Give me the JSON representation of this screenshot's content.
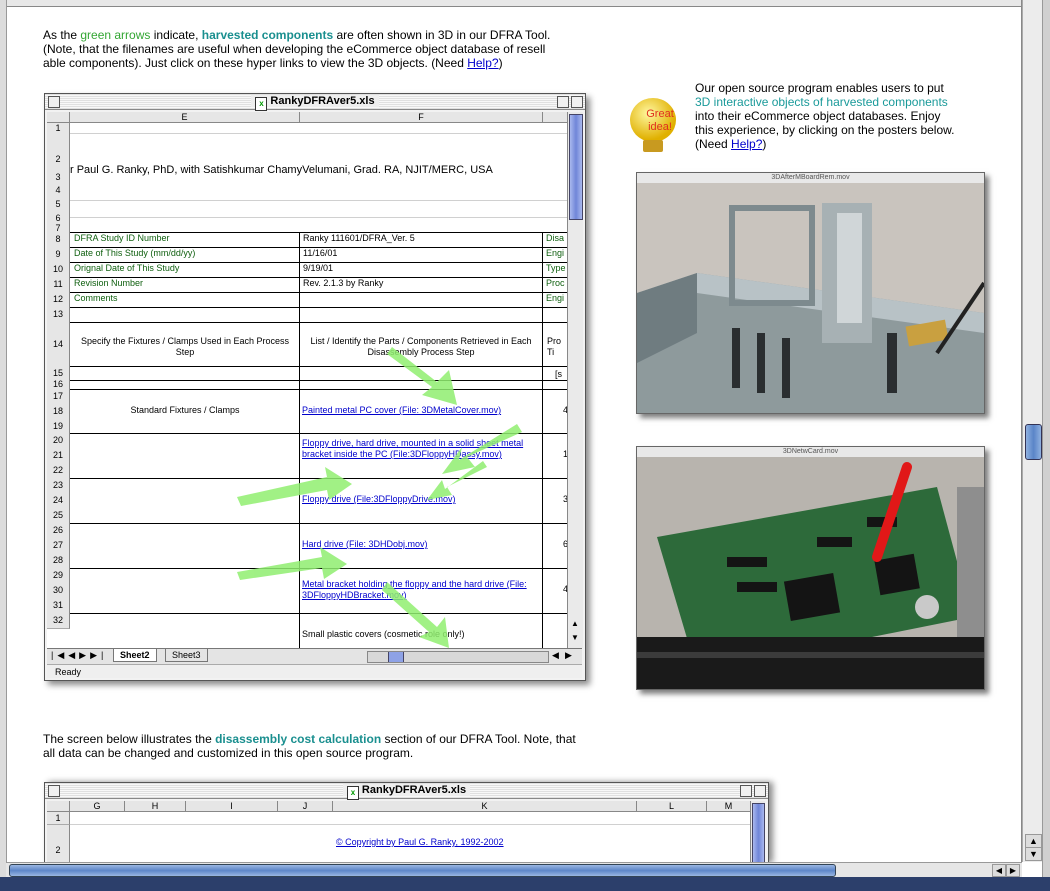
{
  "intro": {
    "t1": "As the ",
    "green": "green arrows",
    "t2": " indicate, ",
    "teal": "harvested components",
    "t3": " are often shown in 3D in our DFRA Tool.",
    "line2": "(Note, that the filenames are useful when developing the eCommerce object database of resell",
    "line3a": "able components). Just click on these hyper links to view the 3D objects. (Need ",
    "help": "Help?",
    "line3b": ")"
  },
  "side_text": {
    "line1": "Our open source program enables users to put",
    "teal": "3D interactive objects of harvested components",
    "line3": "into their eCommerce object databases. Enjoy",
    "line4": "this experience, by clicking on the posters below.",
    "line5a": "(Need ",
    "help": "Help?",
    "line5b": ")"
  },
  "great_idea": {
    "line1": "Great",
    "line2": "idea!"
  },
  "posters": [
    {
      "title": "3DAfterMBoardRem.mov"
    },
    {
      "title": "3DNetwCard.mov"
    }
  ],
  "sheet1": {
    "title": "RankyDFRAver5.xls",
    "col_e": "E",
    "col_f": "F",
    "rows": [
      "1",
      "2",
      "3",
      "4",
      "5",
      "6",
      "7",
      "8",
      "9",
      "10",
      "11",
      "12",
      "13",
      "14",
      "15",
      "16",
      "17",
      "18",
      "19",
      "20",
      "21",
      "22",
      "23",
      "24",
      "25",
      "26",
      "27",
      "28",
      "29",
      "30",
      "31",
      "32"
    ],
    "author": "r Paul G. Ranky, PhD, with Satishkumar ChamyVelumani, Grad. RA, NJIT/MERC, USA",
    "fields": [
      {
        "label": "DFRA Study ID Number",
        "value": "Ranky 111601/DFRA_Ver. 5",
        "g": "Disa"
      },
      {
        "label": "Date of This Study  (mm/dd/yy)",
        "value": "11/16/01",
        "g": "Engi"
      },
      {
        "label": "Orignal Date of This Study",
        "value": "9/19/01",
        "g": "Type"
      },
      {
        "label": "Revision Number",
        "value": "Rev. 2.1.3 by Ranky",
        "g": "Proc"
      },
      {
        "label": "Comments",
        "value": "",
        "g": "Engi"
      }
    ],
    "hdr_e": "Specify the Fixtures / Clamps Used in Each Process Step",
    "hdr_f": "List / Identify the Parts / Components Retrieved in Each Disassembly Process Step",
    "hdr_g": "Pro Ti",
    "g15": "[s",
    "fixtures": "Standard Fixtures / Clamps",
    "links": [
      "Painted metal PC cover (File: 3DMetalCover.mov)",
      "Floppy drive, hard drive, mounted in a solid sheet metal bracket inside the PC (File:3DFloppyHDassy.mov)",
      "Floppy drive (File:3DFloppyDrive.mov)",
      "Hard drive (File: 3DHDobj.mov)",
      "Metal bracket holding the floppy and the hard drive (File: 3DFloppyHDBracket.mov)"
    ],
    "plain": "Small plastic covers (cosmetic role only!)",
    "g_vals": [
      "4",
      "1",
      "3",
      "6",
      "4"
    ],
    "tabs": [
      "Sheet2",
      "Sheet3"
    ],
    "status": "Ready"
  },
  "mid_text": {
    "t1": "The screen below illustrates the ",
    "teal": "disassembly cost calculation",
    "t2": " section of our DFRA Tool. Note, that",
    "line2": "all data can be changed and customized in this open source program."
  },
  "sheet2": {
    "title": "RankyDFRAver5.xls",
    "cols": [
      "G",
      "H",
      "I",
      "J",
      "K",
      "L",
      "M"
    ],
    "rows": [
      "1",
      "2"
    ],
    "copyright": "© Copyright by Paul G. Ranky, 1992-2002"
  },
  "colors": {
    "arrow": "#90ee70",
    "teal": "#1a8f8f",
    "green_text": "#33a633",
    "link": "#0000cc"
  }
}
